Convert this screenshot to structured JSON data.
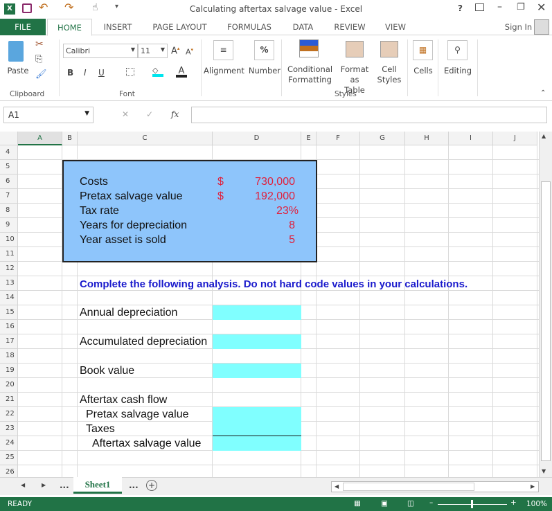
{
  "window": {
    "title": "Calculating aftertax salvage value - Excel",
    "help": "?",
    "sign_in": "Sign In"
  },
  "tabs": [
    "FILE",
    "HOME",
    "INSERT",
    "PAGE LAYOUT",
    "FORMULAS",
    "DATA",
    "REVIEW",
    "VIEW"
  ],
  "ribbon": {
    "clipboard": {
      "paste": "Paste",
      "group": "Clipboard"
    },
    "font": {
      "name": "Calibri",
      "size": "11",
      "bold": "B",
      "italic": "I",
      "underline": "U",
      "group": "Font"
    },
    "alignment": "Alignment",
    "number": "Number",
    "conditional": [
      "Conditional",
      "Formatting"
    ],
    "format_table": [
      "Format as",
      "Table"
    ],
    "cell_styles": [
      "Cell",
      "Styles"
    ],
    "styles_group": "Styles",
    "cells": "Cells",
    "editing": "Editing"
  },
  "formula_bar": {
    "name_box": "A1",
    "fx": "fx",
    "value": ""
  },
  "columns": [
    "A",
    "B",
    "C",
    "D",
    "E",
    "F",
    "G",
    "H",
    "I",
    "J"
  ],
  "rows": [
    "4",
    "5",
    "6",
    "7",
    "8",
    "9",
    "10",
    "11",
    "12",
    "13",
    "14",
    "15",
    "16",
    "17",
    "18",
    "19",
    "20",
    "21",
    "22",
    "23",
    "24",
    "25",
    "26"
  ],
  "inputs": {
    "costs": {
      "label": "Costs",
      "cur": "$",
      "value": "730,000"
    },
    "pretax": {
      "label": "Pretax salvage value",
      "cur": "$",
      "value": "192,000"
    },
    "tax_rate": {
      "label": "Tax rate",
      "value": "23%"
    },
    "years_dep": {
      "label": "Years for depreciation",
      "value": "8"
    },
    "year_sold": {
      "label": "Year asset is sold",
      "value": "5"
    }
  },
  "instruction": "Complete the following analysis. Do not hard code values in your calculations.",
  "analysis": {
    "annual_dep": "Annual depreciation",
    "accum_dep": "Accumulated depreciation",
    "book_value": "Book value",
    "cash_flow": "Aftertax cash flow",
    "pretax": "Pretax salvage value",
    "taxes": "Taxes",
    "aftertax": "Aftertax salvage value"
  },
  "sheet_tabs": {
    "active": "Sheet1",
    "more": "..."
  },
  "status": {
    "ready": "READY",
    "zoom": "100%"
  },
  "colors": {
    "accent": "#217346",
    "input_box": "#8ec5fb",
    "answer_cell": "#80ffff",
    "value_red": "#e0203c",
    "instruction": "#1a1acc"
  }
}
